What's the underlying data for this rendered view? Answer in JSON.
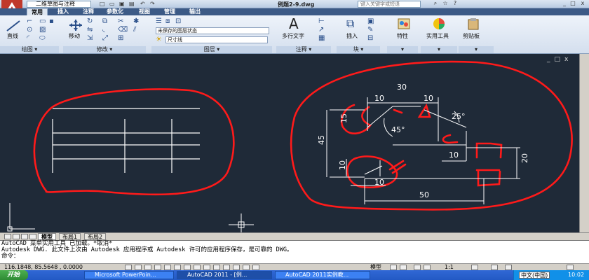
{
  "titlebar": {
    "workspace": "二维草图与注释",
    "doc_title": "例题2-9.dwg",
    "help_placeholder": "键入关键字或短语"
  },
  "tabs": [
    "常用",
    "插入",
    "注释",
    "参数化",
    "视图",
    "管理",
    "输出"
  ],
  "ribbon": {
    "draw": {
      "line": "直线",
      "label": "绘图"
    },
    "modify": {
      "move": "移动",
      "label": "修改"
    },
    "layers": {
      "state": "未保存的图层状态",
      "current": "尺寸线",
      "label": "图层"
    },
    "annotation": {
      "mtext": "多行文字",
      "label": "注释"
    },
    "block": {
      "insert": "插入",
      "label": "块"
    },
    "props": "特性",
    "utils": "实用工具",
    "clip": "剪贴板"
  },
  "viewport_buttons": [
    "_",
    "□",
    "x"
  ],
  "drawing": {
    "dims": {
      "top_total": "30",
      "left_10": "10",
      "right_10": "10",
      "left_15": "15",
      "angle_25": "25°",
      "angle_45": "45°",
      "height_45": "45",
      "mid_10": "10",
      "height_20": "20",
      "lower_10v": "10",
      "lower_10h": "10",
      "bottom_total": "50"
    },
    "colors": {
      "background": "#1f2a38",
      "lines": "#ffffff",
      "markup": "#ff1a1a"
    }
  },
  "layout_tabs": [
    "模型",
    "布局1",
    "布局2"
  ],
  "command": {
    "lines": [
      "AutoCAD 菜单实用工具 已加载。*取消*",
      "Autodesk DWG.  此文件上次由 Autodesk 应用程序或 Autodesk 许可的应用程序保存，是可靠的 DWG。",
      "命令："
    ]
  },
  "status": {
    "coords": "116.1848, 85.5648 , 0.0000",
    "mode": "模型",
    "scale": "1:1"
  },
  "taskbar": {
    "start": "开始",
    "tasks": [
      "Microsoft PowerPoin...",
      "AutoCAD 2011 - [例...",
      "AutoCAD 2011实例教..."
    ],
    "lang": "中文(中国)",
    "clock": "10:02"
  }
}
